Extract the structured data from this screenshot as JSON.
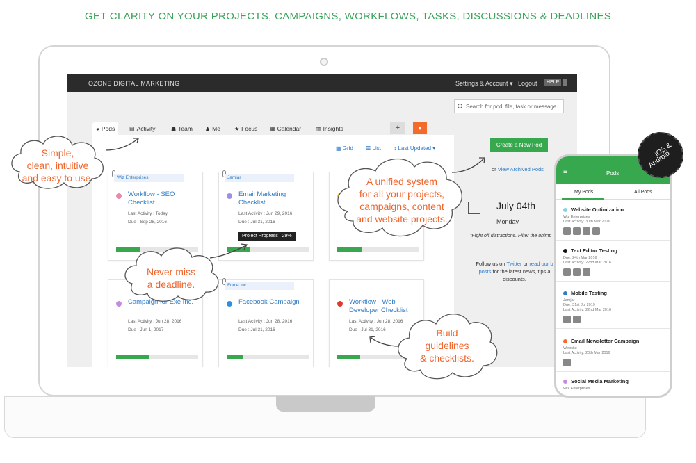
{
  "headline": "GET CLARITY ON YOUR PROJECTS, CAMPAIGNS, WORKFLOWS, TASKS, DISCUSSIONS & DEADLINES",
  "app": {
    "brand": "OZONE DIGITAL MARKETING",
    "settings_label": "Settings & Account ▾",
    "logout_label": "Logout",
    "help_label": "HELP",
    "search_placeholder": "Search for pod, file, task or message",
    "tabs": [
      {
        "icon": "pods-icon",
        "label": "Pods"
      },
      {
        "icon": "activity-icon",
        "label": "Activity"
      },
      {
        "icon": "team-icon",
        "label": "Team"
      },
      {
        "icon": "me-icon",
        "label": "Me"
      },
      {
        "icon": "focus-icon",
        "label": "Focus"
      },
      {
        "icon": "calendar-icon",
        "label": "Calendar"
      },
      {
        "icon": "insights-icon",
        "label": "Insights"
      }
    ],
    "plus_label": "+",
    "view": {
      "grid": "Grid",
      "list": "List",
      "sort": "Last Updated ▾"
    },
    "cards": [
      {
        "org": "Wiz Enterprises",
        "title": "Workflow - SEO Checklist",
        "activity": "Last Activity : Today",
        "due": "Due : Sep 28, 2016",
        "color": "#e88aa8",
        "progress": 0.3
      },
      {
        "org": "Jamjar",
        "title": "Email Marketing Checklist",
        "activity": "Last Activity : Jun 29, 2016",
        "due": "Due : Jul 31, 2016",
        "color": "#9b8fe6",
        "progress": 0.29
      },
      {
        "org": "",
        "title": "",
        "activity": "",
        "due": "",
        "color": "#f5c242",
        "progress": 0.3
      },
      {
        "org": "",
        "title": "Campaign for Exe Inc.",
        "activity": "Last Activity : Jun 28, 2016",
        "due": "Due : Jun 1, 2017",
        "color": "#c58be0",
        "progress": 0.4
      },
      {
        "org": "Force Inc.",
        "title": "Facebook Campaign",
        "activity": "Last Activity : Jun 28, 2016",
        "due": "Due : Jul 31, 2016",
        "color": "#2f8fe0",
        "progress": 0.2
      },
      {
        "org": "",
        "title": "Workflow - Web Developer Checklist",
        "activity": "Last Activity : Jun 28, 2016",
        "due": "Due : Jul 31, 2016",
        "color": "#e03a2f",
        "progress": 0.28
      }
    ],
    "tooltip": "Project Progress : 29%",
    "create_label": "Create a New Pod",
    "archived_prefix": "or",
    "archived_link": "View Archived Pods",
    "date": "July 04th",
    "weekday": "Monday",
    "quote": "\"Fight off distractions. Filter the unimp",
    "follow_text1": "Follow us on",
    "follow_link1": "Twitter",
    "follow_text2": "or",
    "follow_link2": "read our b",
    "follow_link3": "posts",
    "follow_text3": "for the latest news, tips a",
    "follow_text4": "discounts."
  },
  "bubbles": {
    "b1": [
      "Simple,",
      "clean, intuitive",
      "and easy to use."
    ],
    "b2": [
      "A unified system",
      "for all your projects,",
      "campaigns, content",
      "and website projects."
    ],
    "b3": [
      "Never miss",
      "a deadline."
    ],
    "b4": [
      "Build",
      "guidelines",
      "& checklists."
    ]
  },
  "phone": {
    "title": "Pods",
    "tab_my": "My Pods",
    "tab_all": "All Pods",
    "pods": [
      {
        "name": "Website Optimization",
        "org": "Wiz Enterprises",
        "line": "Last Activity: 30th Mar 2016",
        "color": "#7fd3e6"
      },
      {
        "name": "Text Editor Testing",
        "org": "Due: 24th Mar 2016",
        "line": "Last Activity: 22nd Mar 2016",
        "color": "#111111"
      },
      {
        "name": "Mobile Testing",
        "org": "Jamjar",
        "line": "Due: 31st Jul 2019",
        "line2": "Last Activity: 22nd Mar 2016",
        "color": "#2f7bc5"
      },
      {
        "name": "Email Newsletter Campaign",
        "org": "Website",
        "line": "Last Activity: 20th Mar 2016",
        "color": "#f26b2a"
      },
      {
        "name": "Social Media Marketing",
        "org": "Wiz Enterprises",
        "line": "",
        "color": "#c58be0"
      }
    ]
  },
  "badge": {
    "line1": "iOS &",
    "line2": "Android"
  }
}
